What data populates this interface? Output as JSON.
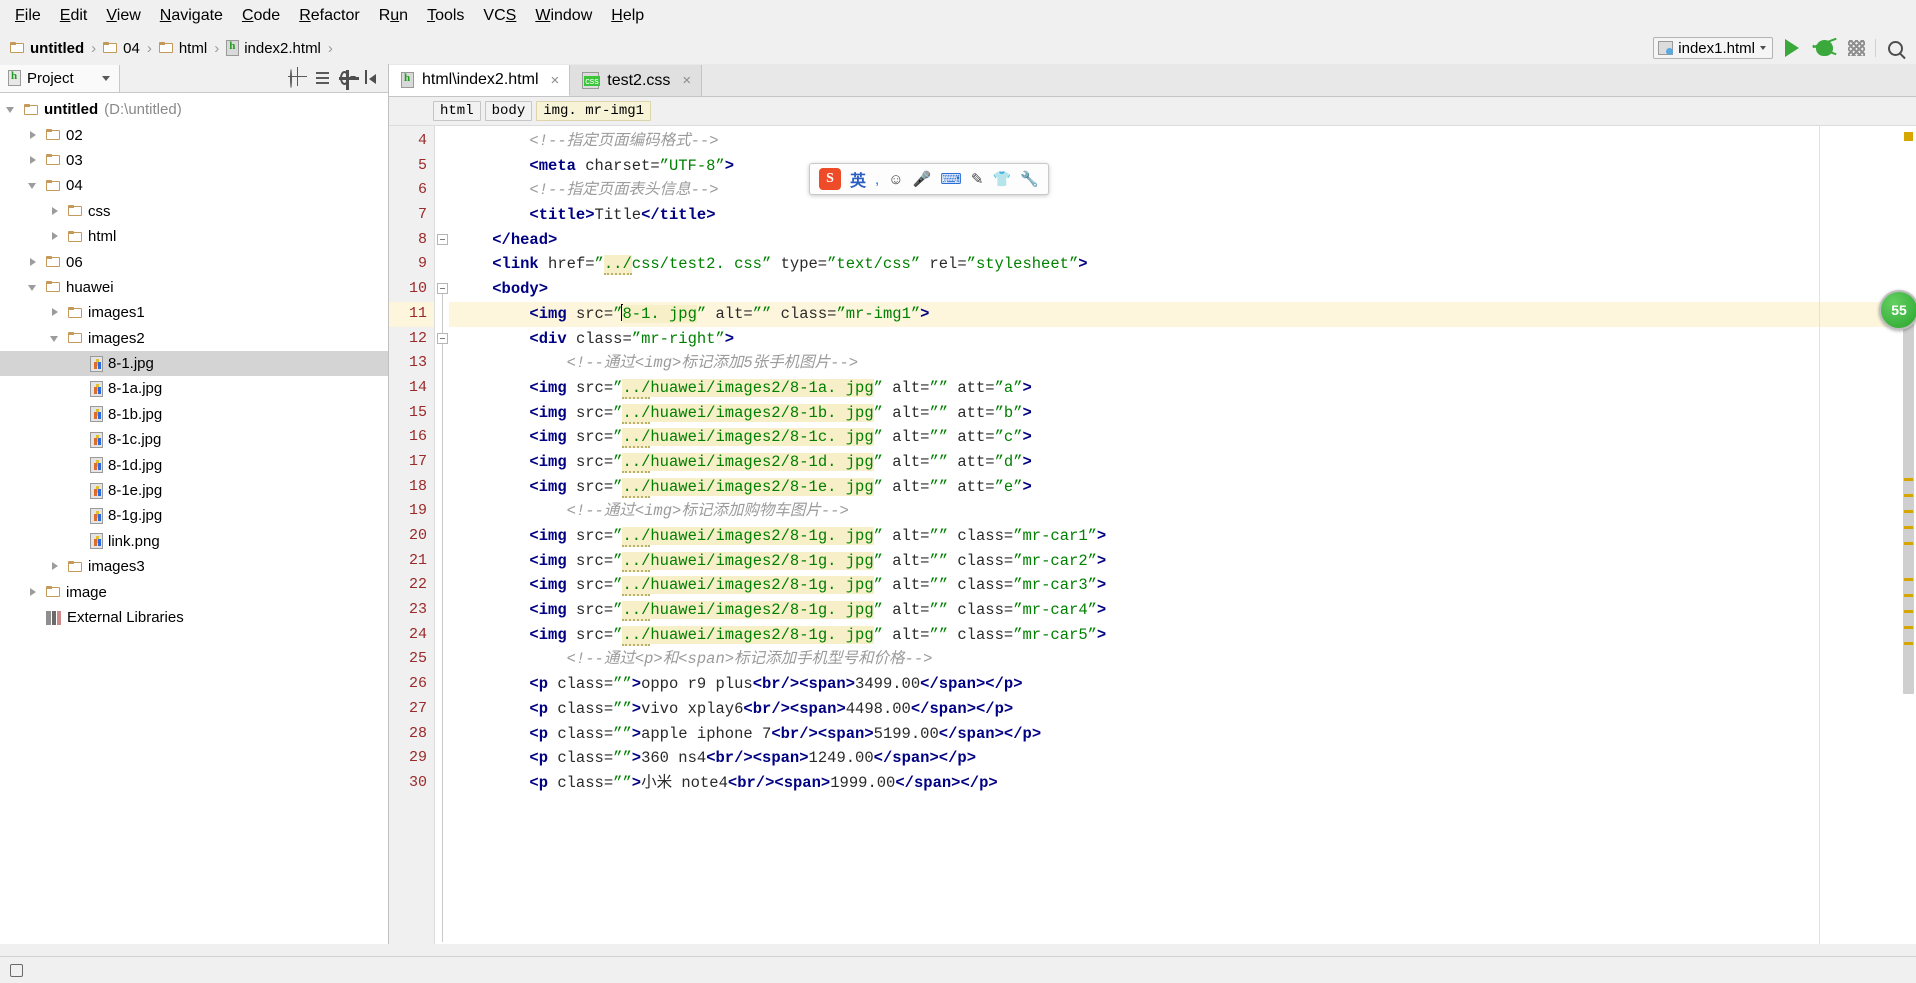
{
  "menu": [
    "File",
    "Edit",
    "View",
    "Navigate",
    "Code",
    "Refactor",
    "Run",
    "Tools",
    "VCS",
    "Window",
    "Help"
  ],
  "navbar": {
    "breadcrumbs": [
      {
        "label": "untitled",
        "icon": "folder-icon",
        "bold": true
      },
      {
        "label": "04",
        "icon": "folder-icon",
        "bold": false
      },
      {
        "label": "html",
        "icon": "folder-icon",
        "bold": false
      },
      {
        "label": "index2.html",
        "icon": "html-file-icon",
        "bold": false
      }
    ],
    "separator": "›",
    "run_config": "index1.html",
    "run_button": "run-icon",
    "debug_button": "debug-icon",
    "coverage_button": "coverage-icon",
    "search_button": "search-icon"
  },
  "project_panel": {
    "tab_label": "Project",
    "tools": [
      "target-icon",
      "collapse-all-icon",
      "settings-gear-icon",
      "hide-panel-icon"
    ],
    "tree": [
      {
        "label": "untitled",
        "suffix": "(D:\\untitled)",
        "indent": 0,
        "twisty": "down",
        "icon": "folder-icon",
        "bold": true,
        "selected": false
      },
      {
        "label": "02",
        "suffix": "",
        "indent": 1,
        "twisty": "right",
        "icon": "folder-icon",
        "bold": false,
        "selected": false
      },
      {
        "label": "03",
        "suffix": "",
        "indent": 1,
        "twisty": "right",
        "icon": "folder-icon",
        "bold": false,
        "selected": false
      },
      {
        "label": "04",
        "suffix": "",
        "indent": 1,
        "twisty": "down",
        "icon": "folder-icon",
        "bold": false,
        "selected": false
      },
      {
        "label": "css",
        "suffix": "",
        "indent": 2,
        "twisty": "right",
        "icon": "folder-icon",
        "bold": false,
        "selected": false
      },
      {
        "label": "html",
        "suffix": "",
        "indent": 2,
        "twisty": "right",
        "icon": "folder-icon",
        "bold": false,
        "selected": false
      },
      {
        "label": "06",
        "suffix": "",
        "indent": 1,
        "twisty": "right",
        "icon": "folder-icon",
        "bold": false,
        "selected": false
      },
      {
        "label": "huawei",
        "suffix": "",
        "indent": 1,
        "twisty": "down",
        "icon": "folder-icon",
        "bold": false,
        "selected": false
      },
      {
        "label": "images1",
        "suffix": "",
        "indent": 2,
        "twisty": "right",
        "icon": "folder-icon",
        "bold": false,
        "selected": false
      },
      {
        "label": "images2",
        "suffix": "",
        "indent": 2,
        "twisty": "down",
        "icon": "folder-icon",
        "bold": false,
        "selected": false
      },
      {
        "label": "8-1.jpg",
        "suffix": "",
        "indent": 3,
        "twisty": "none",
        "icon": "image-file-icon",
        "bold": false,
        "selected": true
      },
      {
        "label": "8-1a.jpg",
        "suffix": "",
        "indent": 3,
        "twisty": "none",
        "icon": "image-file-icon",
        "bold": false,
        "selected": false
      },
      {
        "label": "8-1b.jpg",
        "suffix": "",
        "indent": 3,
        "twisty": "none",
        "icon": "image-file-icon",
        "bold": false,
        "selected": false
      },
      {
        "label": "8-1c.jpg",
        "suffix": "",
        "indent": 3,
        "twisty": "none",
        "icon": "image-file-icon",
        "bold": false,
        "selected": false
      },
      {
        "label": "8-1d.jpg",
        "suffix": "",
        "indent": 3,
        "twisty": "none",
        "icon": "image-file-icon",
        "bold": false,
        "selected": false
      },
      {
        "label": "8-1e.jpg",
        "suffix": "",
        "indent": 3,
        "twisty": "none",
        "icon": "image-file-icon",
        "bold": false,
        "selected": false
      },
      {
        "label": "8-1g.jpg",
        "suffix": "",
        "indent": 3,
        "twisty": "none",
        "icon": "image-file-icon",
        "bold": false,
        "selected": false
      },
      {
        "label": "link.png",
        "suffix": "",
        "indent": 3,
        "twisty": "none",
        "icon": "image-file-icon",
        "bold": false,
        "selected": false
      },
      {
        "label": "images3",
        "suffix": "",
        "indent": 2,
        "twisty": "right",
        "icon": "folder-icon",
        "bold": false,
        "selected": false
      },
      {
        "label": "image",
        "suffix": "",
        "indent": 1,
        "twisty": "right",
        "icon": "folder-icon",
        "bold": false,
        "selected": false
      },
      {
        "label": "External Libraries",
        "suffix": "",
        "indent": 1,
        "twisty": "none",
        "icon": "libraries-icon",
        "bold": false,
        "selected": false
      }
    ]
  },
  "editor": {
    "tabs": [
      {
        "label": "html\\index2.html",
        "icon": "html-file-icon",
        "active": true,
        "close": "×"
      },
      {
        "label": "test2.css",
        "icon": "css-file-icon",
        "active": false,
        "close": "×"
      }
    ],
    "element_breadcrumbs": [
      {
        "label": "html",
        "highlight": false
      },
      {
        "label": "body",
        "highlight": false
      },
      {
        "label": "img. mr-img1",
        "highlight": true
      }
    ],
    "first_line_number": 4,
    "current_line": 11,
    "lines": [
      {
        "n": 4,
        "text": "        <!--指定页面编码格式-->"
      },
      {
        "n": 5,
        "text": "        <meta charset=\"UTF-8\">"
      },
      {
        "n": 6,
        "text": "        <!--指定页面表头信息-->"
      },
      {
        "n": 7,
        "text": "        <title>Title</title>"
      },
      {
        "n": 8,
        "text": "    </head>"
      },
      {
        "n": 9,
        "text": "    <link href=\"../css/test2. css\" type=\"text/css\" rel=\"stylesheet\">"
      },
      {
        "n": 10,
        "text": "    <body>"
      },
      {
        "n": 11,
        "text": "        <img src=\"8-1. jpg\" alt=\"\" class=\"mr-img1\">"
      },
      {
        "n": 12,
        "text": "        <div class=\"mr-right\">"
      },
      {
        "n": 13,
        "text": "            <!--通过<img>标记添加5张手机图片-->"
      },
      {
        "n": 14,
        "text": "        <img src=\"../huawei/images2/8-1a. jpg\" alt=\"\" att=\"a\">"
      },
      {
        "n": 15,
        "text": "        <img src=\"../huawei/images2/8-1b. jpg\" alt=\"\" att=\"b\">"
      },
      {
        "n": 16,
        "text": "        <img src=\"../huawei/images2/8-1c. jpg\" alt=\"\" att=\"c\">"
      },
      {
        "n": 17,
        "text": "        <img src=\"../huawei/images2/8-1d. jpg\" alt=\"\" att=\"d\">"
      },
      {
        "n": 18,
        "text": "        <img src=\"../huawei/images2/8-1e. jpg\" alt=\"\" att=\"e\">"
      },
      {
        "n": 19,
        "text": "            <!--通过<img>标记添加购物车图片-->"
      },
      {
        "n": 20,
        "text": "        <img src=\"../huawei/images2/8-1g. jpg\" alt=\"\" class=\"mr-car1\">"
      },
      {
        "n": 21,
        "text": "        <img src=\"../huawei/images2/8-1g. jpg\" alt=\"\" class=\"mr-car2\">"
      },
      {
        "n": 22,
        "text": "        <img src=\"../huawei/images2/8-1g. jpg\" alt=\"\" class=\"mr-car3\">"
      },
      {
        "n": 23,
        "text": "        <img src=\"../huawei/images2/8-1g. jpg\" alt=\"\" class=\"mr-car4\">"
      },
      {
        "n": 24,
        "text": "        <img src=\"../huawei/images2/8-1g. jpg\" alt=\"\" class=\"mr-car5\">"
      },
      {
        "n": 25,
        "text": "            <!--通过<p>和<span>标记添加手机型号和价格-->"
      },
      {
        "n": 26,
        "text": "        <p class=\"\">oppo r9 plus<br/><span>3499.00</span></p>"
      },
      {
        "n": 27,
        "text": "        <p class=\"\">vivo xplay6<br/><span>4498.00</span></p>"
      },
      {
        "n": 28,
        "text": "        <p class=\"\">apple iphone 7<br/><span>5199.00</span></p>"
      },
      {
        "n": 29,
        "text": "        <p class=\"\">360 ns4<br/><span>1249.00</span></p>"
      },
      {
        "n": 30,
        "text": "        <p class=\"\">小米 note4<br/><span>1999.00</span></p>"
      }
    ],
    "inspection_badge": "55"
  },
  "ime_toolbar": {
    "logo": "S",
    "mode": "英",
    "items": [
      "punctuation-toggle",
      "emoji-icon",
      "voice-input-icon",
      "keyboard-icon",
      "handwriting-icon",
      "skin-icon",
      "tools-icon"
    ]
  },
  "colors": {
    "accent_green": "#3aa83a",
    "tag_blue": "#000083",
    "string_green": "#008000",
    "comment_gray": "#9b9b9b",
    "line_number_red": "#9a2a2a",
    "current_line_bg": "#fdf6dd",
    "highlight_bg": "#f7efc8"
  }
}
